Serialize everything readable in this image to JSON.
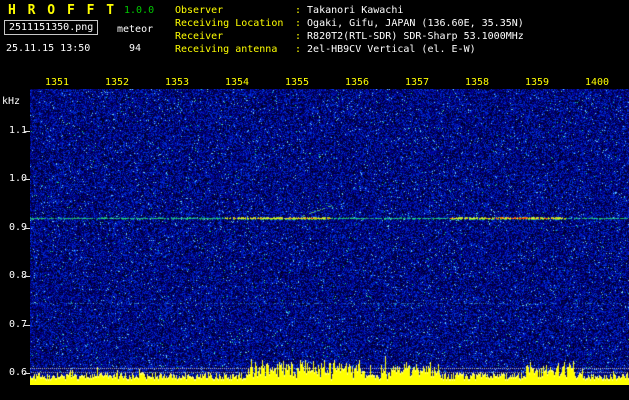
{
  "app": {
    "title_letters": "H R O F F T",
    "version": "1.0.0",
    "filename": "2511151350.png",
    "mode": "meteor",
    "datetime": "25.11.15 13:50",
    "count": "94"
  },
  "info": {
    "colon": ":",
    "rows": [
      {
        "label": "Observer",
        "value": "Takanori Kawachi"
      },
      {
        "label": "Receiving Location",
        "value": "Ogaki, Gifu, JAPAN (136.60E, 35.35N)"
      },
      {
        "label": "Receiver",
        "value": "R820T2(RTL-SDR) SDR-Sharp 53.1000MHz"
      },
      {
        "label": "Receiving antenna",
        "value": "2el-HB9CV Vertical (el. E-W)"
      }
    ]
  },
  "spectrogram": {
    "time_labels": [
      "1351",
      "1352",
      "1353",
      "1354",
      "1355",
      "1356",
      "1357",
      "1358",
      "1359",
      "1400"
    ],
    "freq_unit": "kHz",
    "freq_labels": [
      "1.1",
      "1.0",
      "0.9",
      "0.8",
      "0.7",
      "0.6"
    ],
    "trace_khz": 0.92,
    "colors": {
      "noise_blue": "#2030e0",
      "trace_green": "#30c878",
      "trace_hot_yellow": "#ffe030",
      "trace_hot_red": "#ff4800",
      "band_yellow": "#ffff00",
      "label_yellow": "#ffff00",
      "label_white": "#ffffff",
      "version_green": "#00c800",
      "background": "#000000"
    }
  }
}
